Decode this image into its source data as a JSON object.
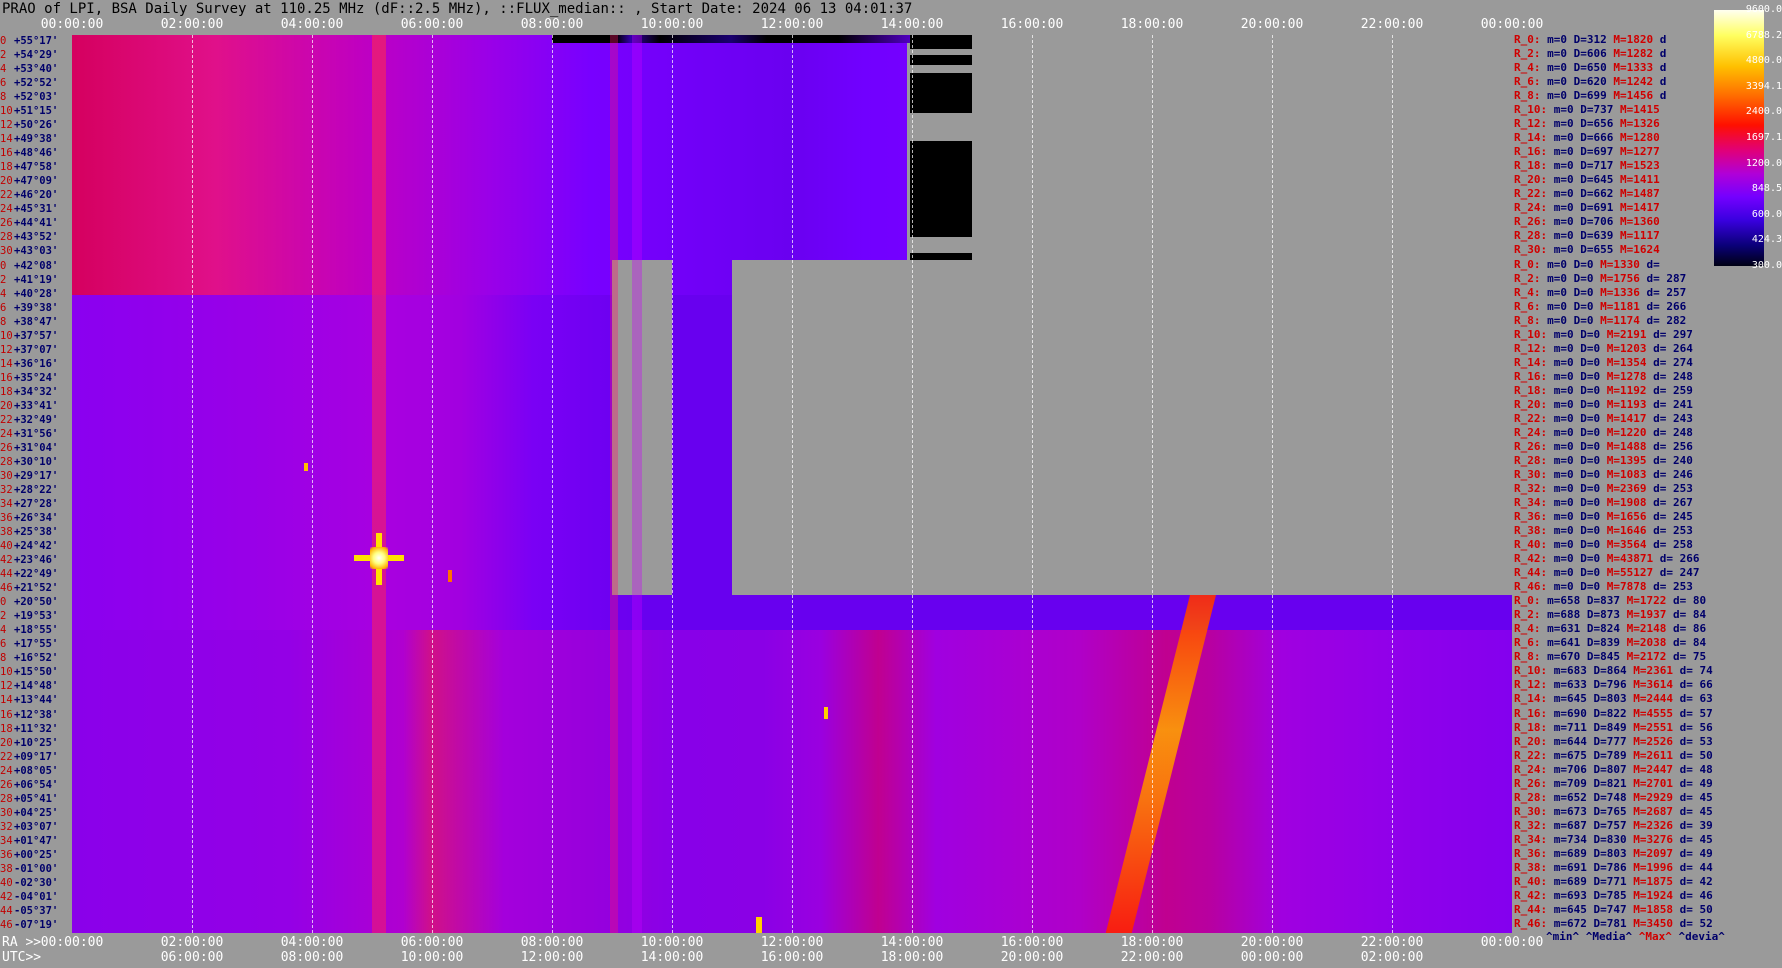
{
  "title": "PRAO of LPI, BSA Daily Survey at 110.25 MHz (dF::2.5 MHz), ::FLUX_median:: , Start Date: 2024 06 13 04:01:37",
  "top_axis": [
    "00:00:00",
    "02:00:00",
    "04:00:00",
    "06:00:00",
    "08:00:00",
    "10:00:00",
    "12:00:00",
    "14:00:00",
    "16:00:00",
    "18:00:00",
    "20:00:00",
    "22:00:00",
    "00:00:00"
  ],
  "bottom_axis_prefix": "RA >>",
  "bottom_axis": [
    "00:00:00",
    "02:00:00",
    "04:00:00",
    "06:00:00",
    "08:00:00",
    "10:00:00",
    "12:00:00",
    "14:00:00",
    "16:00:00",
    "18:00:00",
    "20:00:00",
    "22:00:00",
    "00:00:00"
  ],
  "bottom_axis2_prefix": "UTC>>",
  "bottom_axis2": [
    "06:00:00",
    "08:00:00",
    "10:00:00",
    "12:00:00",
    "14:00:00",
    "16:00:00",
    "18:00:00",
    "20:00:00",
    "22:00:00",
    "00:00:00",
    "02:00:00"
  ],
  "declinations": [
    {
      "i": "0",
      "d": "+55°17'"
    },
    {
      "i": "2",
      "d": "+54°29'"
    },
    {
      "i": "4",
      "d": "+53°40'"
    },
    {
      "i": "6",
      "d": "+52°52'"
    },
    {
      "i": "8",
      "d": "+52°03'"
    },
    {
      "i": "10",
      "d": "+51°15'"
    },
    {
      "i": "12",
      "d": "+50°26'"
    },
    {
      "i": "14",
      "d": "+49°38'"
    },
    {
      "i": "16",
      "d": "+48°46'"
    },
    {
      "i": "18",
      "d": "+47°58'"
    },
    {
      "i": "20",
      "d": "+47°09'"
    },
    {
      "i": "22",
      "d": "+46°20'"
    },
    {
      "i": "24",
      "d": "+45°31'"
    },
    {
      "i": "26",
      "d": "+44°41'"
    },
    {
      "i": "28",
      "d": "+43°52'"
    },
    {
      "i": "30",
      "d": "+43°03'"
    },
    {
      "i": "0",
      "d": "+42°08'"
    },
    {
      "i": "2",
      "d": "+41°19'"
    },
    {
      "i": "4",
      "d": "+40°28'"
    },
    {
      "i": "6",
      "d": "+39°38'"
    },
    {
      "i": "8",
      "d": "+38°47'"
    },
    {
      "i": "10",
      "d": "+37°57'"
    },
    {
      "i": "12",
      "d": "+37°07'"
    },
    {
      "i": "14",
      "d": "+36°16'"
    },
    {
      "i": "16",
      "d": "+35°24'"
    },
    {
      "i": "18",
      "d": "+34°32'"
    },
    {
      "i": "20",
      "d": "+33°41'"
    },
    {
      "i": "22",
      "d": "+32°49'"
    },
    {
      "i": "24",
      "d": "+31°56'"
    },
    {
      "i": "26",
      "d": "+31°04'"
    },
    {
      "i": "28",
      "d": "+30°10'"
    },
    {
      "i": "30",
      "d": "+29°17'"
    },
    {
      "i": "32",
      "d": "+28°22'"
    },
    {
      "i": "34",
      "d": "+27°28'"
    },
    {
      "i": "36",
      "d": "+26°34'"
    },
    {
      "i": "38",
      "d": "+25°38'"
    },
    {
      "i": "40",
      "d": "+24°42'"
    },
    {
      "i": "42",
      "d": "+23°46'"
    },
    {
      "i": "44",
      "d": "+22°49'"
    },
    {
      "i": "46",
      "d": "+21°52'"
    },
    {
      "i": "0",
      "d": "+20°50'"
    },
    {
      "i": "2",
      "d": "+19°53'"
    },
    {
      "i": "4",
      "d": "+18°55'"
    },
    {
      "i": "6",
      "d": "+17°55'"
    },
    {
      "i": "8",
      "d": "+16°52'"
    },
    {
      "i": "10",
      "d": "+15°50'"
    },
    {
      "i": "12",
      "d": "+14°48'"
    },
    {
      "i": "14",
      "d": "+13°44'"
    },
    {
      "i": "16",
      "d": "+12°38'"
    },
    {
      "i": "18",
      "d": "+11°32'"
    },
    {
      "i": "20",
      "d": "+10°25'"
    },
    {
      "i": "22",
      "d": "+09°17'"
    },
    {
      "i": "24",
      "d": "+08°05'"
    },
    {
      "i": "26",
      "d": "+06°54'"
    },
    {
      "i": "28",
      "d": "+05°41'"
    },
    {
      "i": "30",
      "d": "+04°25'"
    },
    {
      "i": "32",
      "d": "+03°07'"
    },
    {
      "i": "34",
      "d": "+01°47'"
    },
    {
      "i": "36",
      "d": "+00°25'"
    },
    {
      "i": "38",
      "d": "-01°00'"
    },
    {
      "i": "40",
      "d": "-02°30'"
    },
    {
      "i": "42",
      "d": "-04°01'"
    },
    {
      "i": "44",
      "d": "-05°37'"
    },
    {
      "i": "46",
      "d": "-07°19'"
    }
  ],
  "stats": [
    {
      "r": "R_0:",
      "m": "m=0",
      "D": "D=312",
      "M": "M=1820",
      "d": "d"
    },
    {
      "r": "R_2:",
      "m": "m=0",
      "D": "D=606",
      "M": "M=1282",
      "d": "d"
    },
    {
      "r": "R_4:",
      "m": "m=0",
      "D": "D=650",
      "M": "M=1333",
      "d": "d"
    },
    {
      "r": "R_6:",
      "m": "m=0",
      "D": "D=620",
      "M": "M=1242",
      "d": "d"
    },
    {
      "r": "R_8:",
      "m": "m=0",
      "D": "D=699",
      "M": "M=1456",
      "d": "d"
    },
    {
      "r": "R_10:",
      "m": "m=0",
      "D": "D=737",
      "M": "M=1415",
      "d": ""
    },
    {
      "r": "R_12:",
      "m": "m=0",
      "D": "D=656",
      "M": "M=1326",
      "d": ""
    },
    {
      "r": "R_14:",
      "m": "m=0",
      "D": "D=666",
      "M": "M=1280",
      "d": ""
    },
    {
      "r": "R_16:",
      "m": "m=0",
      "D": "D=697",
      "M": "M=1277",
      "d": ""
    },
    {
      "r": "R_18:",
      "m": "m=0",
      "D": "D=717",
      "M": "M=1523",
      "d": ""
    },
    {
      "r": "R_20:",
      "m": "m=0",
      "D": "D=645",
      "M": "M=1411",
      "d": ""
    },
    {
      "r": "R_22:",
      "m": "m=0",
      "D": "D=662",
      "M": "M=1487",
      "d": ""
    },
    {
      "r": "R_24:",
      "m": "m=0",
      "D": "D=691",
      "M": "M=1417",
      "d": ""
    },
    {
      "r": "R_26:",
      "m": "m=0",
      "D": "D=706",
      "M": "M=1360",
      "d": ""
    },
    {
      "r": "R_28:",
      "m": "m=0",
      "D": "D=639",
      "M": "M=1117",
      "d": ""
    },
    {
      "r": "R_30:",
      "m": "m=0",
      "D": "D=655",
      "M": "M=1624",
      "d": ""
    },
    {
      "r": "R_0:",
      "m": "m=0",
      "D": "D=0",
      "M": "M=1330",
      "d": "d="
    },
    {
      "r": "R_2:",
      "m": "m=0",
      "D": "D=0",
      "M": "M=1756",
      "d": "d= 287"
    },
    {
      "r": "R_4:",
      "m": "m=0",
      "D": "D=0",
      "M": "M=1336",
      "d": "d= 257"
    },
    {
      "r": "R_6:",
      "m": "m=0",
      "D": "D=0",
      "M": "M=1181",
      "d": "d= 266"
    },
    {
      "r": "R_8:",
      "m": "m=0",
      "D": "D=0",
      "M": "M=1174",
      "d": "d= 282"
    },
    {
      "r": "R_10:",
      "m": "m=0",
      "D": "D=0",
      "M": "M=2191",
      "d": "d= 297"
    },
    {
      "r": "R_12:",
      "m": "m=0",
      "D": "D=0",
      "M": "M=1203",
      "d": "d= 264"
    },
    {
      "r": "R_14:",
      "m": "m=0",
      "D": "D=0",
      "M": "M=1354",
      "d": "d= 274"
    },
    {
      "r": "R_16:",
      "m": "m=0",
      "D": "D=0",
      "M": "M=1278",
      "d": "d= 248"
    },
    {
      "r": "R_18:",
      "m": "m=0",
      "D": "D=0",
      "M": "M=1192",
      "d": "d= 259"
    },
    {
      "r": "R_20:",
      "m": "m=0",
      "D": "D=0",
      "M": "M=1193",
      "d": "d= 241"
    },
    {
      "r": "R_22:",
      "m": "m=0",
      "D": "D=0",
      "M": "M=1417",
      "d": "d= 243"
    },
    {
      "r": "R_24:",
      "m": "m=0",
      "D": "D=0",
      "M": "M=1220",
      "d": "d= 248"
    },
    {
      "r": "R_26:",
      "m": "m=0",
      "D": "D=0",
      "M": "M=1488",
      "d": "d= 256"
    },
    {
      "r": "R_28:",
      "m": "m=0",
      "D": "D=0",
      "M": "M=1395",
      "d": "d= 240"
    },
    {
      "r": "R_30:",
      "m": "m=0",
      "D": "D=0",
      "M": "M=1083",
      "d": "d= 246"
    },
    {
      "r": "R_32:",
      "m": "m=0",
      "D": "D=0",
      "M": "M=2369",
      "d": "d= 253"
    },
    {
      "r": "R_34:",
      "m": "m=0",
      "D": "D=0",
      "M": "M=1908",
      "d": "d= 267"
    },
    {
      "r": "R_36:",
      "m": "m=0",
      "D": "D=0",
      "M": "M=1656",
      "d": "d= 245"
    },
    {
      "r": "R_38:",
      "m": "m=0",
      "D": "D=0",
      "M": "M=1646",
      "d": "d= 253"
    },
    {
      "r": "R_40:",
      "m": "m=0",
      "D": "D=0",
      "M": "M=3564",
      "d": "d= 258"
    },
    {
      "r": "R_42:",
      "m": "m=0",
      "D": "D=0",
      "M": "M=43871",
      "d": "d= 266"
    },
    {
      "r": "R_44:",
      "m": "m=0",
      "D": "D=0",
      "M": "M=55127",
      "d": "d= 247"
    },
    {
      "r": "R_46:",
      "m": "m=0",
      "D": "D=0",
      "M": "M=7878",
      "d": "d= 253"
    },
    {
      "r": "R_0:",
      "m": "m=658",
      "D": "D=837",
      "M": "M=1722",
      "d": "d= 80"
    },
    {
      "r": "R_2:",
      "m": "m=688",
      "D": "D=873",
      "M": "M=1937",
      "d": "d= 84"
    },
    {
      "r": "R_4:",
      "m": "m=631",
      "D": "D=824",
      "M": "M=2148",
      "d": "d= 86"
    },
    {
      "r": "R_6:",
      "m": "m=641",
      "D": "D=839",
      "M": "M=2038",
      "d": "d= 84"
    },
    {
      "r": "R_8:",
      "m": "m=670",
      "D": "D=845",
      "M": "M=2172",
      "d": "d= 75"
    },
    {
      "r": "R_10:",
      "m": "m=683",
      "D": "D=864",
      "M": "M=2361",
      "d": "d= 74"
    },
    {
      "r": "R_12:",
      "m": "m=633",
      "D": "D=796",
      "M": "M=3614",
      "d": "d= 66"
    },
    {
      "r": "R_14:",
      "m": "m=645",
      "D": "D=803",
      "M": "M=2444",
      "d": "d= 63"
    },
    {
      "r": "R_16:",
      "m": "m=690",
      "D": "D=822",
      "M": "M=4555",
      "d": "d= 57"
    },
    {
      "r": "R_18:",
      "m": "m=711",
      "D": "D=849",
      "M": "M=2551",
      "d": "d= 56"
    },
    {
      "r": "R_20:",
      "m": "m=644",
      "D": "D=777",
      "M": "M=2526",
      "d": "d= 53"
    },
    {
      "r": "R_22:",
      "m": "m=675",
      "D": "D=789",
      "M": "M=2611",
      "d": "d= 50"
    },
    {
      "r": "R_24:",
      "m": "m=706",
      "D": "D=807",
      "M": "M=2447",
      "d": "d= 48"
    },
    {
      "r": "R_26:",
      "m": "m=709",
      "D": "D=821",
      "M": "M=2701",
      "d": "d= 49"
    },
    {
      "r": "R_28:",
      "m": "m=652",
      "D": "D=748",
      "M": "M=2929",
      "d": "d= 45"
    },
    {
      "r": "R_30:",
      "m": "m=673",
      "D": "D=765",
      "M": "M=2687",
      "d": "d= 45"
    },
    {
      "r": "R_32:",
      "m": "m=687",
      "D": "D=757",
      "M": "M=2326",
      "d": "d= 39"
    },
    {
      "r": "R_34:",
      "m": "m=734",
      "D": "D=830",
      "M": "M=3276",
      "d": "d= 45"
    },
    {
      "r": "R_36:",
      "m": "m=689",
      "D": "D=803",
      "M": "M=2097",
      "d": "d= 49"
    },
    {
      "r": "R_38:",
      "m": "m=691",
      "D": "D=786",
      "M": "M=1996",
      "d": "d= 44"
    },
    {
      "r": "R_40:",
      "m": "m=689",
      "D": "D=771",
      "M": "M=1875",
      "d": "d= 42"
    },
    {
      "r": "R_42:",
      "m": "m=693",
      "D": "D=785",
      "M": "M=1924",
      "d": "d= 46"
    },
    {
      "r": "R_44:",
      "m": "m=645",
      "D": "D=747",
      "M": "M=1858",
      "d": "d= 50"
    },
    {
      "r": "R_46:",
      "m": "m=672",
      "D": "D=781",
      "M": "M=3450",
      "d": "d= 52"
    }
  ],
  "stats_legend": {
    "min": "^min^",
    "median": "^Media^",
    "max": "^Max^",
    "devia": "^devia^"
  },
  "colorbar_labels": [
    "9600.0",
    "6788.2",
    "4800.0",
    "3394.1",
    "2400.0",
    "1697.1",
    "1200.0",
    "848.5",
    "600.0",
    "424.3",
    "300.0"
  ],
  "colors": {
    "background": "#9a9a9a",
    "text_red": "#d00000",
    "text_navy": "#00006a",
    "plot_low": "#6a00ff",
    "plot_mid": "#a000e0",
    "plot_high": "#ff1060"
  }
}
